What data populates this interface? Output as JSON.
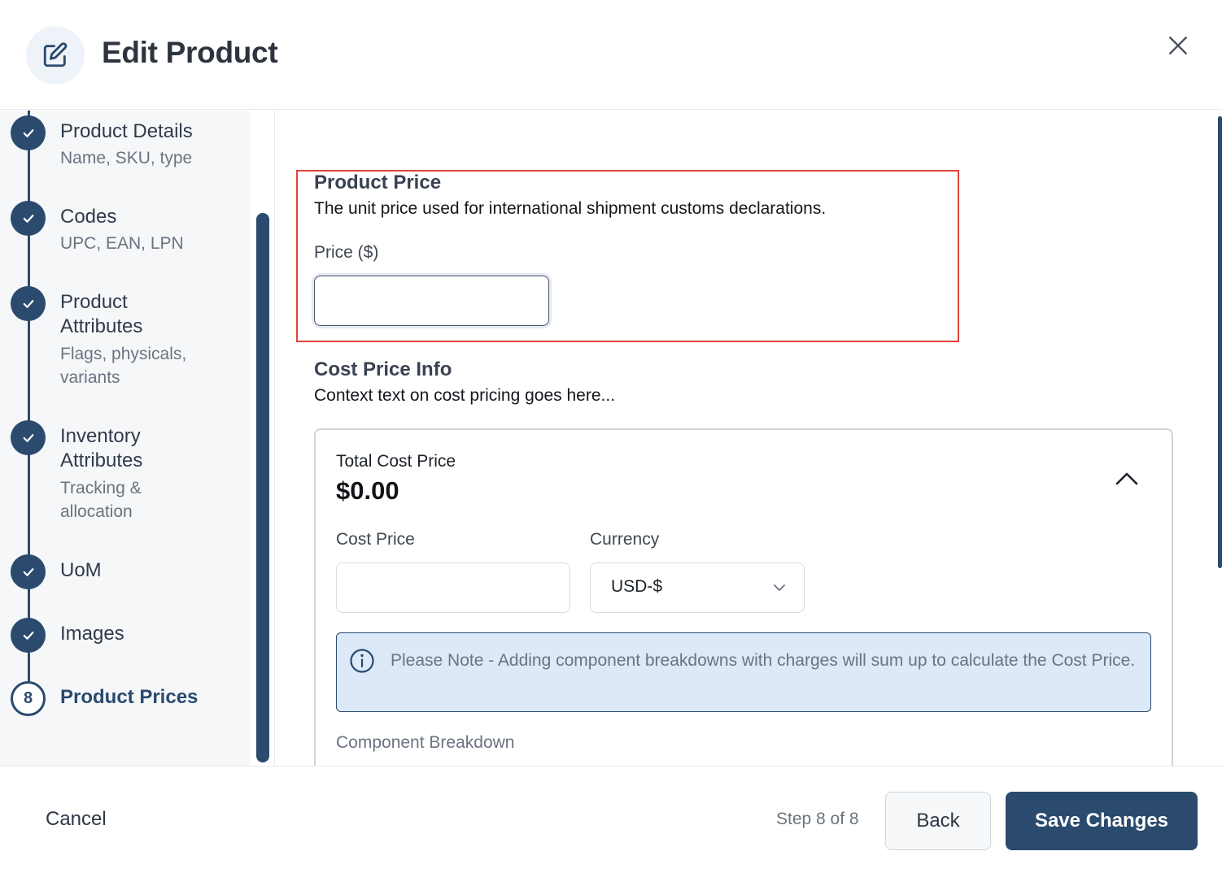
{
  "header": {
    "icon": "edit-icon",
    "title": "Edit Product",
    "close_icon": "close-icon"
  },
  "sidebar": {
    "steps": [
      {
        "title": "Product Details",
        "subtitle": "Name, SKU, type",
        "status": "complete",
        "icon": "check-icon"
      },
      {
        "title": "Codes",
        "subtitle": "UPC, EAN, LPN",
        "status": "complete",
        "icon": "check-icon"
      },
      {
        "title_line1": "Product",
        "title_line2": "Attributes",
        "subtitle_line1": "Flags, physicals,",
        "subtitle_line2": "variants",
        "status": "complete",
        "icon": "check-icon"
      },
      {
        "title_line1": "Inventory",
        "title_line2": "Attributes",
        "subtitle_line1": "Tracking &",
        "subtitle_line2": "allocation",
        "status": "complete",
        "icon": "check-icon"
      },
      {
        "title": "UoM",
        "status": "complete",
        "icon": "check-icon"
      },
      {
        "title": "Images",
        "status": "complete",
        "icon": "check-icon"
      },
      {
        "number": "8",
        "title": "Product Prices",
        "status": "current"
      }
    ]
  },
  "product_price": {
    "title": "Product Price",
    "description": "The unit price used for international shipment customs declarations.",
    "price_label": "Price ($)",
    "price_value": "",
    "highlight_color": "#e0453a"
  },
  "cost_price": {
    "title": "Cost Price Info",
    "description": "Context text on cost pricing goes here...",
    "total_label": "Total Cost Price",
    "total_value": "$0.00",
    "collapse_icon": "chevron-up-icon",
    "cost_label": "Cost Price",
    "cost_value": "",
    "currency_label": "Currency",
    "currency_value": "USD-$",
    "note_icon": "info-icon",
    "note_text": "Please Note - Adding component breakdowns with charges will sum up to calculate the Cost Price.",
    "component_label": "Component Breakdown"
  },
  "footer": {
    "cancel_label": "Cancel",
    "step_counter": "Step 8 of 8",
    "back_label": "Back",
    "save_label": "Save Changes"
  },
  "colors": {
    "primary": "#2a4a6e",
    "note_background": "#dde8f8"
  }
}
